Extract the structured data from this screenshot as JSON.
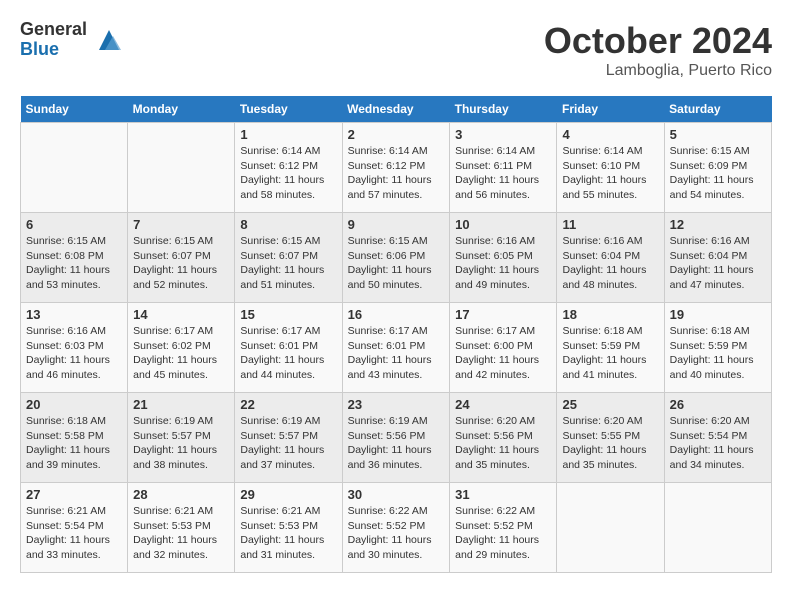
{
  "header": {
    "logo_general": "General",
    "logo_blue": "Blue",
    "month_title": "October 2024",
    "location": "Lamboglia, Puerto Rico"
  },
  "days_of_week": [
    "Sunday",
    "Monday",
    "Tuesday",
    "Wednesday",
    "Thursday",
    "Friday",
    "Saturday"
  ],
  "weeks": [
    [
      {
        "day": "",
        "info": ""
      },
      {
        "day": "",
        "info": ""
      },
      {
        "day": "1",
        "info": "Sunrise: 6:14 AM\nSunset: 6:12 PM\nDaylight: 11 hours and 58 minutes."
      },
      {
        "day": "2",
        "info": "Sunrise: 6:14 AM\nSunset: 6:12 PM\nDaylight: 11 hours and 57 minutes."
      },
      {
        "day": "3",
        "info": "Sunrise: 6:14 AM\nSunset: 6:11 PM\nDaylight: 11 hours and 56 minutes."
      },
      {
        "day": "4",
        "info": "Sunrise: 6:14 AM\nSunset: 6:10 PM\nDaylight: 11 hours and 55 minutes."
      },
      {
        "day": "5",
        "info": "Sunrise: 6:15 AM\nSunset: 6:09 PM\nDaylight: 11 hours and 54 minutes."
      }
    ],
    [
      {
        "day": "6",
        "info": "Sunrise: 6:15 AM\nSunset: 6:08 PM\nDaylight: 11 hours and 53 minutes."
      },
      {
        "day": "7",
        "info": "Sunrise: 6:15 AM\nSunset: 6:07 PM\nDaylight: 11 hours and 52 minutes."
      },
      {
        "day": "8",
        "info": "Sunrise: 6:15 AM\nSunset: 6:07 PM\nDaylight: 11 hours and 51 minutes."
      },
      {
        "day": "9",
        "info": "Sunrise: 6:15 AM\nSunset: 6:06 PM\nDaylight: 11 hours and 50 minutes."
      },
      {
        "day": "10",
        "info": "Sunrise: 6:16 AM\nSunset: 6:05 PM\nDaylight: 11 hours and 49 minutes."
      },
      {
        "day": "11",
        "info": "Sunrise: 6:16 AM\nSunset: 6:04 PM\nDaylight: 11 hours and 48 minutes."
      },
      {
        "day": "12",
        "info": "Sunrise: 6:16 AM\nSunset: 6:04 PM\nDaylight: 11 hours and 47 minutes."
      }
    ],
    [
      {
        "day": "13",
        "info": "Sunrise: 6:16 AM\nSunset: 6:03 PM\nDaylight: 11 hours and 46 minutes."
      },
      {
        "day": "14",
        "info": "Sunrise: 6:17 AM\nSunset: 6:02 PM\nDaylight: 11 hours and 45 minutes."
      },
      {
        "day": "15",
        "info": "Sunrise: 6:17 AM\nSunset: 6:01 PM\nDaylight: 11 hours and 44 minutes."
      },
      {
        "day": "16",
        "info": "Sunrise: 6:17 AM\nSunset: 6:01 PM\nDaylight: 11 hours and 43 minutes."
      },
      {
        "day": "17",
        "info": "Sunrise: 6:17 AM\nSunset: 6:00 PM\nDaylight: 11 hours and 42 minutes."
      },
      {
        "day": "18",
        "info": "Sunrise: 6:18 AM\nSunset: 5:59 PM\nDaylight: 11 hours and 41 minutes."
      },
      {
        "day": "19",
        "info": "Sunrise: 6:18 AM\nSunset: 5:59 PM\nDaylight: 11 hours and 40 minutes."
      }
    ],
    [
      {
        "day": "20",
        "info": "Sunrise: 6:18 AM\nSunset: 5:58 PM\nDaylight: 11 hours and 39 minutes."
      },
      {
        "day": "21",
        "info": "Sunrise: 6:19 AM\nSunset: 5:57 PM\nDaylight: 11 hours and 38 minutes."
      },
      {
        "day": "22",
        "info": "Sunrise: 6:19 AM\nSunset: 5:57 PM\nDaylight: 11 hours and 37 minutes."
      },
      {
        "day": "23",
        "info": "Sunrise: 6:19 AM\nSunset: 5:56 PM\nDaylight: 11 hours and 36 minutes."
      },
      {
        "day": "24",
        "info": "Sunrise: 6:20 AM\nSunset: 5:56 PM\nDaylight: 11 hours and 35 minutes."
      },
      {
        "day": "25",
        "info": "Sunrise: 6:20 AM\nSunset: 5:55 PM\nDaylight: 11 hours and 35 minutes."
      },
      {
        "day": "26",
        "info": "Sunrise: 6:20 AM\nSunset: 5:54 PM\nDaylight: 11 hours and 34 minutes."
      }
    ],
    [
      {
        "day": "27",
        "info": "Sunrise: 6:21 AM\nSunset: 5:54 PM\nDaylight: 11 hours and 33 minutes."
      },
      {
        "day": "28",
        "info": "Sunrise: 6:21 AM\nSunset: 5:53 PM\nDaylight: 11 hours and 32 minutes."
      },
      {
        "day": "29",
        "info": "Sunrise: 6:21 AM\nSunset: 5:53 PM\nDaylight: 11 hours and 31 minutes."
      },
      {
        "day": "30",
        "info": "Sunrise: 6:22 AM\nSunset: 5:52 PM\nDaylight: 11 hours and 30 minutes."
      },
      {
        "day": "31",
        "info": "Sunrise: 6:22 AM\nSunset: 5:52 PM\nDaylight: 11 hours and 29 minutes."
      },
      {
        "day": "",
        "info": ""
      },
      {
        "day": "",
        "info": ""
      }
    ]
  ]
}
